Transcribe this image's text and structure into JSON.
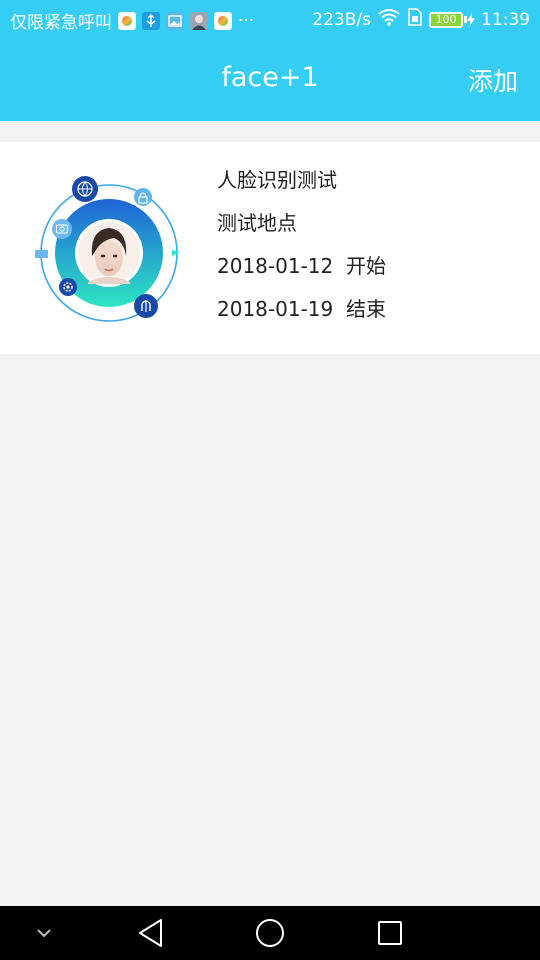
{
  "status_bar": {
    "carrier": "仅限紧急呼叫",
    "notification_icons": [
      "app-icon",
      "usb-icon",
      "image-icon",
      "avatar-icon",
      "app-icon"
    ],
    "more": "···",
    "net_speed": "223B/s",
    "battery": "100",
    "time": "11:39"
  },
  "app_bar": {
    "title": "face+1",
    "add_label": "添加"
  },
  "card": {
    "title": "人脸识别测试",
    "location": "测试地点",
    "start_date": "2018-01-12",
    "start_label": "开始",
    "end_date": "2018-01-19",
    "end_label": "结束"
  },
  "nav_bar": {
    "icons": [
      "collapse-icon",
      "back-icon",
      "home-icon",
      "recents-icon"
    ]
  },
  "colors": {
    "accent": "#36cdf5",
    "background": "#f3f3f3",
    "card": "#ffffff",
    "text": "#222222"
  }
}
